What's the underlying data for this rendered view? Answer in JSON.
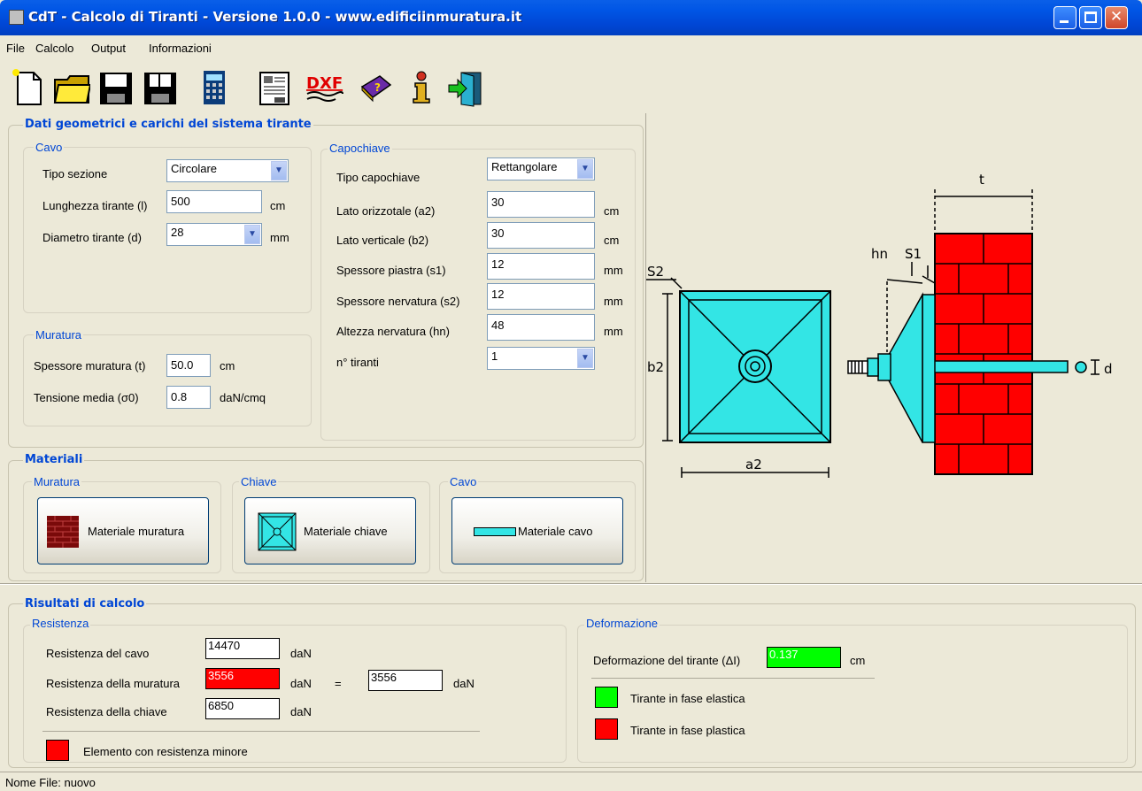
{
  "window": {
    "title": "CdT  -  Calcolo di Tiranti  -  Versione 1.0.0   -  www.edificiinmuratura.it"
  },
  "menu": [
    "File",
    "Calcolo",
    "Output",
    "Informazioni"
  ],
  "toolbar": {
    "icons": [
      "new-file",
      "open-folder",
      "save",
      "save-as",
      "calculator",
      "report",
      "dxf-export",
      "help-book",
      "info",
      "exit"
    ],
    "dxf_label": "DXF"
  },
  "geom": {
    "title": "Dati geometrici e carichi del sistema tirante",
    "cavo": {
      "legend": "Cavo",
      "tipo_label": "Tipo sezione",
      "tipo_value": "Circolare",
      "lung_label": "Lunghezza tirante (l)",
      "lung_value": "500",
      "lung_unit": "cm",
      "diam_label": "Diametro tirante (d)",
      "diam_value": "28",
      "diam_unit": "mm"
    },
    "muratura": {
      "legend": "Muratura",
      "spess_label": "Spessore muratura (t)",
      "spess_value": "50.0",
      "spess_unit": "cm",
      "tens_label": "Tensione media  (σ0)",
      "tens_value": "0.8",
      "tens_unit": "daN/cmq"
    },
    "capochiave": {
      "legend": "Capochiave",
      "tipo_label": "Tipo capochiave",
      "tipo_value": "Rettangolare",
      "fields": [
        {
          "label": "Lato orizzotale (a2)",
          "value": "30",
          "unit": "cm"
        },
        {
          "label": "Lato verticale (b2)",
          "value": "30",
          "unit": "cm"
        },
        {
          "label": "Spessore piastra (s1)",
          "value": "12",
          "unit": "mm"
        },
        {
          "label": "Spessore nervatura (s2)",
          "value": "12",
          "unit": "mm"
        },
        {
          "label": "Altezza nervatura (hn)",
          "value": "48",
          "unit": "mm"
        }
      ],
      "ntir_label": "n° tiranti",
      "ntir_value": "1"
    }
  },
  "materiali": {
    "title": "Materiali",
    "muratura_legend": "Muratura",
    "chiave_legend": "Chiave",
    "cavo_legend": "Cavo",
    "btn_muratura": "Materiale muratura",
    "btn_chiave": "Materiale chiave",
    "btn_cavo": "Materiale cavo"
  },
  "drawing": {
    "t": "t",
    "hn": "hn",
    "s1": "S1",
    "s2": "S2",
    "b2": "b2",
    "a2": "a2",
    "d": "d"
  },
  "risultati": {
    "title": "Risultati di calcolo",
    "resistenza_legend": "Resistenza",
    "rows": [
      {
        "label": "Resistenza del cavo",
        "value": "14470",
        "unit": "daN"
      },
      {
        "label": "Resistenza della muratura",
        "value": "3556",
        "unit": "daN"
      },
      {
        "label": "Resistenza della chiave",
        "value": "6850",
        "unit": "daN"
      }
    ],
    "equals": "=",
    "result_value": "3556",
    "result_unit": "daN",
    "legend_min": "Elemento con resistenza minore",
    "deform_legend": "Deformazione",
    "deform_label": "Deformazione del tirante (ΔI)",
    "deform_value": "0.137",
    "deform_unit": "cm",
    "elastic_label": "Tirante in fase elastica",
    "plastic_label": "Tirante in fase plastica"
  },
  "colors": {
    "min": "#ff0000",
    "elastic": "#00ff00",
    "plastic": "#ff0000",
    "cyan": "#33e5e5",
    "brick": "#ff0000"
  },
  "status": "Nome File: nuovo"
}
